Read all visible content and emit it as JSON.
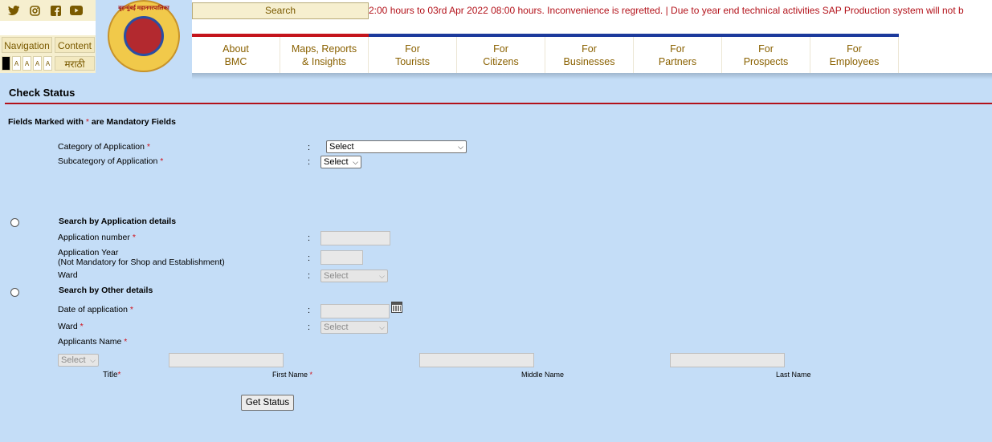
{
  "header": {
    "social_icons": [
      "twitter-icon",
      "instagram-icon",
      "facebook-icon",
      "youtube-icon"
    ],
    "navigation_label": "Navigation",
    "content_label": "Content",
    "font_size_labels": [
      "A",
      "A",
      "A",
      "A"
    ],
    "language_label": "मराठी",
    "logo_text": "बृहन्मुंबई महानगरपालिका",
    "search_label": "Search",
    "ticker": "2:00 hours to 03rd Apr 2022 08:00 hours. Inconvenience is regretted. | Due to year end technical activities SAP Production system will not b",
    "menu": [
      "About\nBMC",
      "Maps, Reports\n& Insights",
      "For\nTourists",
      "For\nCitizens",
      "For\nBusinesses",
      "For\nPartners",
      "For\nProspects",
      "For\nEmployees"
    ]
  },
  "form": {
    "title": "Check Status",
    "mandatory_note": "Fields Marked with",
    "mandatory_note_tail": "are Mandatory Fields",
    "required_mark": "*",
    "colon": ":",
    "category_label": "Category of Application",
    "category_value": "Select",
    "subcategory_label": "Subcategory of Application",
    "subcategory_value": "Select",
    "app_section": "Search by Application details",
    "app_number_label": "Application number",
    "app_year_label": "Application Year",
    "app_year_note": "(Not Mandatory for Shop and Establishment)",
    "ward_label": "Ward",
    "ward_value": "Select",
    "other_section": "Search by Other details",
    "date_label": "Date of application",
    "ward2_label": "Ward",
    "ward2_value": "Select",
    "applicants_label": "Applicants Name",
    "title_value": "Select",
    "title_label": "Title",
    "first_name_label": "First Name",
    "middle_name_label": "Middle Name",
    "last_name_label": "Last Name",
    "submit_label": "Get Status"
  },
  "colors": {
    "accent_red": "#b3121a",
    "nav_blue": "#1c3a9c",
    "background": "#c4ddf7",
    "menu_text": "#8a6100"
  }
}
